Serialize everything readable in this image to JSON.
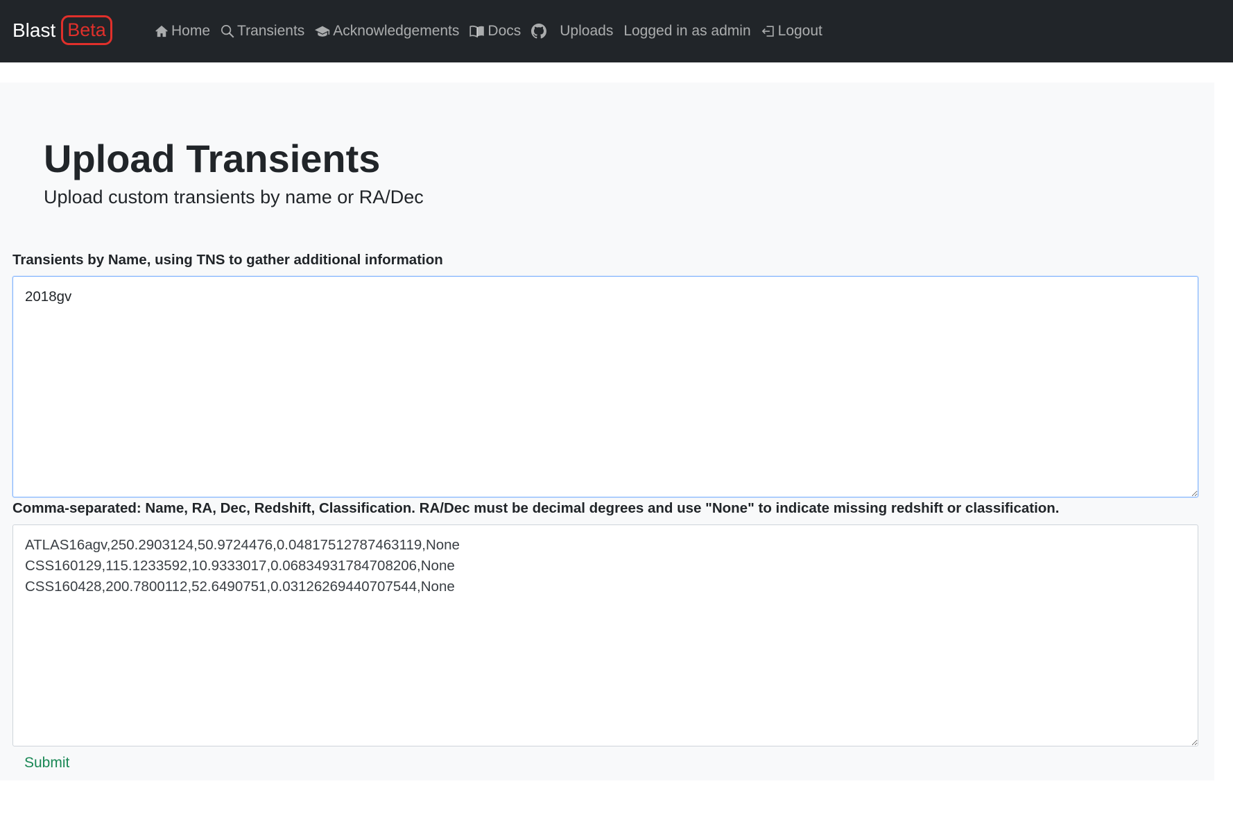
{
  "navbar": {
    "brand": "Blast",
    "badge": "Beta",
    "items": [
      {
        "label": "Home",
        "icon": "home-icon"
      },
      {
        "label": "Transients",
        "icon": "search-icon"
      },
      {
        "label": "Acknowledgements",
        "icon": "graduation-cap-icon"
      },
      {
        "label": "Docs",
        "icon": "book-icon"
      },
      {
        "label": "",
        "icon": "github-icon"
      },
      {
        "label": "Uploads",
        "icon": ""
      },
      {
        "label": "Logged in as admin",
        "icon": ""
      },
      {
        "label": "Logout",
        "icon": "logout-icon"
      }
    ],
    "colors": {
      "background": "#212529",
      "badge": "#e0302b"
    }
  },
  "page": {
    "title": "Upload Transients",
    "subtitle": "Upload custom transients by name or RA/Dec"
  },
  "form": {
    "names_label": "Transients by Name, using TNS to gather additional information",
    "names_value": "2018gv",
    "csv_label": "Comma-separated: Name, RA, Dec, Redshift, Classification. RA/Dec must be decimal degrees and use \"None\" to indicate missing redshift or classification.",
    "csv_value": "ATLAS16agv,250.2903124,50.9724476,0.04817512787463119,None\nCSS160129,115.1233592,10.9333017,0.06834931784708206,None\nCSS160428,200.7800112,52.6490751,0.03126269440707544,None",
    "submit_label": "Submit",
    "submit_color": "#198754"
  }
}
